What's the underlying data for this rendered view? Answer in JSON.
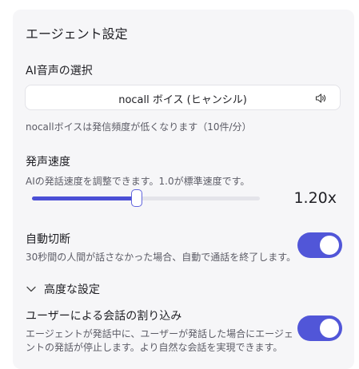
{
  "panel": {
    "title": "エージェント設定"
  },
  "voice": {
    "label": "AI音声の選択",
    "selected": "nocall ボイス (ヒャンシル)",
    "speaker_icon": "speaker-icon",
    "note": "nocallボイスは発信頻度が低くなります（10件/分）"
  },
  "speed": {
    "label": "発声速度",
    "description": "AIの発話速度を調整できます。1.0が標準速度です。",
    "value_text": "1.20x",
    "fill_fraction": 0.46
  },
  "auto_hangup": {
    "label": "自動切断",
    "description": "30秒間の人間が話さなかった場合、自動で通話を終了します。",
    "enabled": true
  },
  "advanced": {
    "label": "高度な設定",
    "chevron_icon": "chevron-down-icon"
  },
  "barge_in": {
    "label": "ユーザーによる会話の割り込み",
    "description_line1": "エージェントが発話中に、ユーザーが発話した場合にエージェ",
    "description_line2": "ントの発話が停止します。より自然な会話を実現できます。",
    "enabled": true
  },
  "colors": {
    "accent": "#5156d8",
    "panel_bg": "#f6f6f8"
  }
}
